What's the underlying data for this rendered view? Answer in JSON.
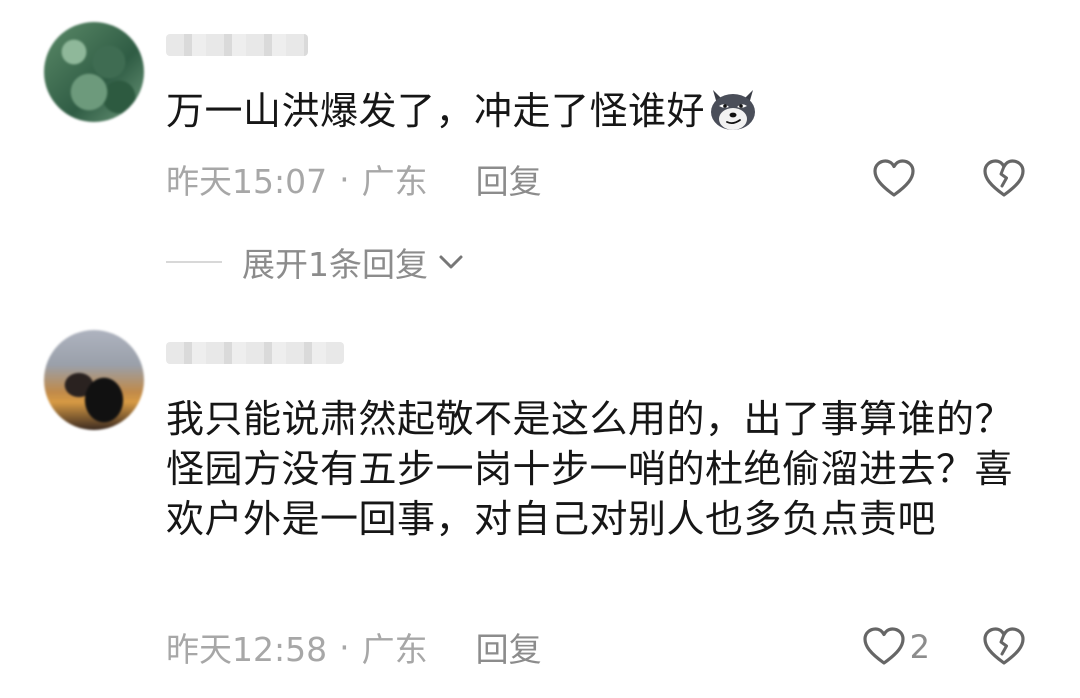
{
  "comments": [
    {
      "text": "万一山洪爆发了，冲走了怪谁好",
      "emoji": "smirking-dog-emoji",
      "time": "昨天15:07",
      "separator": "·",
      "location": "广东",
      "reply_label": "回复",
      "like_count": "",
      "expand_label": "展开1条回复"
    },
    {
      "text": "我只能说肃然起敬不是这么用的，出了事算谁的？怪园方没有五步一岗十步一哨的杜绝偷溜进去？喜欢户外是一回事，对自己对别人也多负点责吧",
      "time": "昨天12:58",
      "separator": "·",
      "location": "广东",
      "reply_label": "回复",
      "like_count": "2"
    }
  ],
  "icons": {
    "like": "heart-outline-icon",
    "dislike": "broken-heart-icon",
    "expand": "chevron-down-icon"
  },
  "colors": {
    "text": "#161616",
    "meta": "#a7a7a7",
    "action": "#8c8c8c"
  }
}
